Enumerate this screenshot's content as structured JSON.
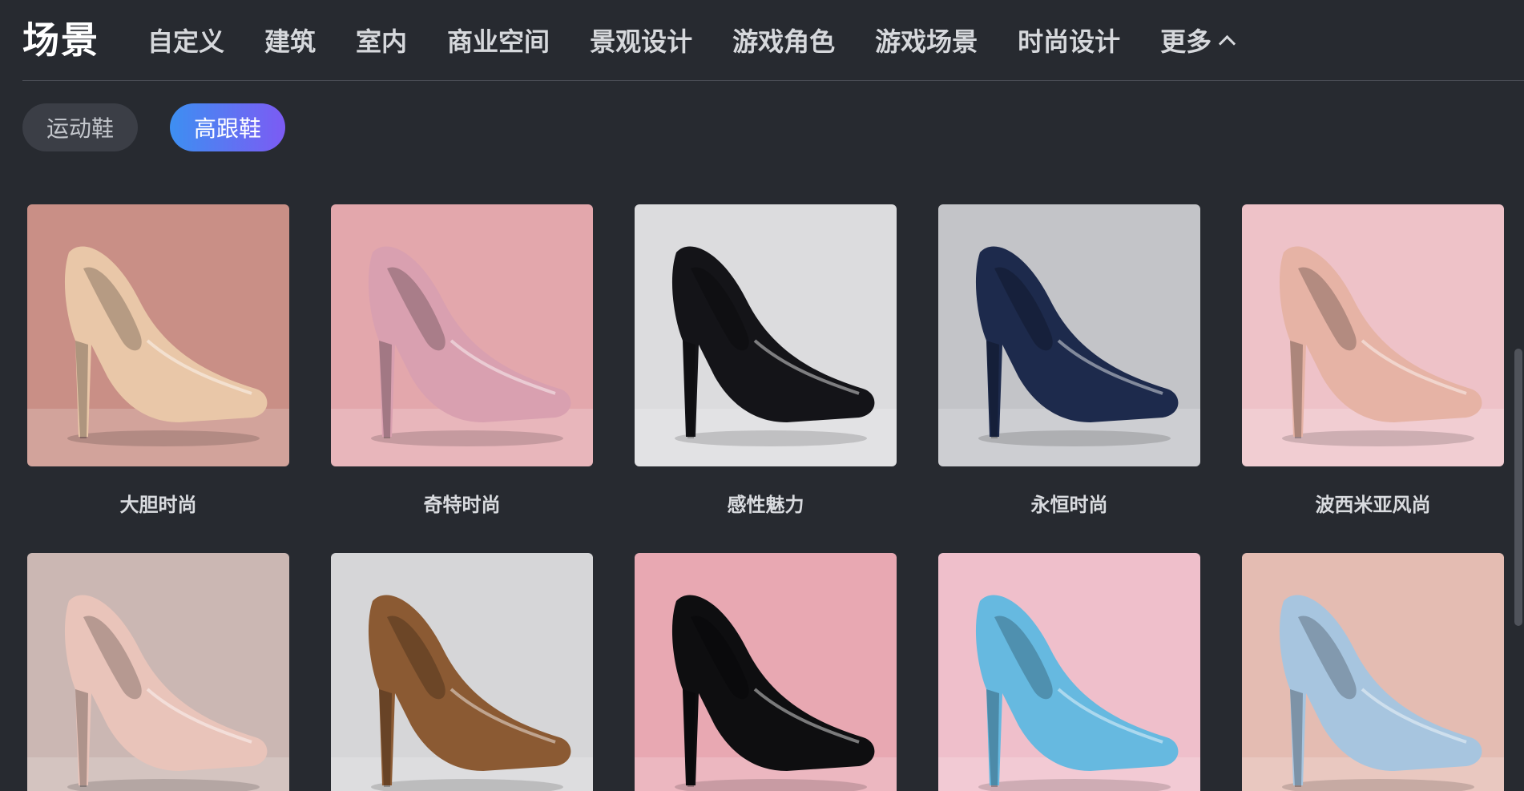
{
  "header": {
    "title": "场景",
    "tabs": [
      {
        "label": "自定义"
      },
      {
        "label": "建筑"
      },
      {
        "label": "室内"
      },
      {
        "label": "商业空间"
      },
      {
        "label": "景观设计"
      },
      {
        "label": "游戏角色"
      },
      {
        "label": "游戏场景"
      },
      {
        "label": "时尚设计"
      }
    ],
    "more_label": "更多",
    "more_icon": "chevron-up-icon"
  },
  "subcategories": [
    {
      "label": "运动鞋",
      "active": false
    },
    {
      "label": "高跟鞋",
      "active": true
    }
  ],
  "gallery": {
    "items": [
      {
        "label": "大胆时尚",
        "bg": "#c98f86",
        "shoe": "#e9c7a8"
      },
      {
        "label": "奇特时尚",
        "bg": "#e3a7ac",
        "shoe": "#d9a0b0"
      },
      {
        "label": "感性魅力",
        "bg": "#dcdcde",
        "shoe": "#141418"
      },
      {
        "label": "永恒时尚",
        "bg": "#c3c4c8",
        "shoe": "#1d2a4c"
      },
      {
        "label": "波西米亚风尚",
        "bg": "#eec2c8",
        "shoe": "#e6b3a5"
      },
      {
        "label": "",
        "bg": "#cbb7b3",
        "shoe": "#e9c4ba"
      },
      {
        "label": "",
        "bg": "#d6d6d8",
        "shoe": "#8b5a33"
      },
      {
        "label": "",
        "bg": "#e8a8b2",
        "shoe": "#0e0e10"
      },
      {
        "label": "",
        "bg": "#efbfcb",
        "shoe": "#66b9e0"
      },
      {
        "label": "",
        "bg": "#e4bcb2",
        "shoe": "#a7c5df"
      }
    ]
  }
}
